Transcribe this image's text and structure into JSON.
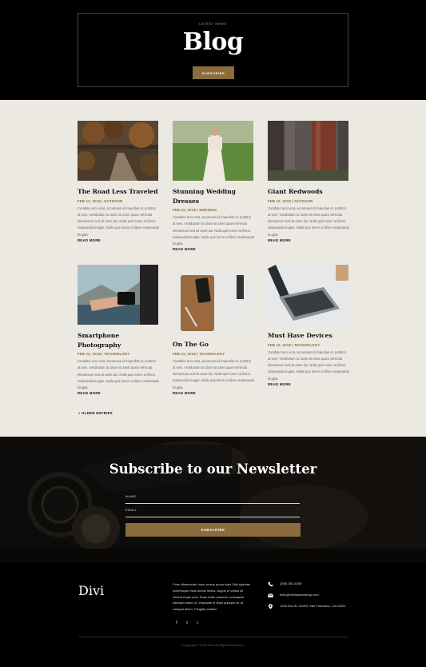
{
  "hero": {
    "kicker": "LATEST NEWS",
    "title": "Blog",
    "button": "SUBSCRIBE"
  },
  "posts": [
    {
      "title": "The Road Less Traveled",
      "meta": "FEB 12, 2018 | OUTDOOR",
      "body": "Curabitur arcu erat, accumsan id imperdiet et, porttitor at sem. Vestibulum ac diam sit amet quam vehicula elementum sed sit amet dui. Nulla quis lorem ut libero malesuada feugiat. Nulla quis lorem ut libero malesuada feugiat.",
      "more": "READ MORE"
    },
    {
      "title": "Stunning Wedding Dresses",
      "meta": "FEB 12, 2018 | WEDDING",
      "body": "Curabitur arcu erat, accumsan id imperdiet et, porttitor at sem. Vestibulum ac diam sit amet quam vehicula elementum sed sit amet dui. Nulla quis lorem ut libero malesuada feugiat. Nulla quis lorem ut libero malesuada feugiat.",
      "more": "READ MORE"
    },
    {
      "title": "Giant Redwoods",
      "meta": "FEB 12, 2018 | OUTDOOR",
      "body": "Curabitur arcu erat, accumsan id imperdiet et, porttitor at sem. Vestibulum ac diam sit amet quam vehicula elementum sed sit amet dui. Nulla quis lorem ut libero malesuada feugiat. Nulla quis lorem ut libero malesuada feugiat.",
      "more": "READ MORE"
    },
    {
      "title": "Smartphone Photography",
      "meta": "FEB 12, 2018 | TECHNOLOGY",
      "body": "Curabitur arcu erat, accumsan id imperdiet et, porttitor at sem. Vestibulum ac diam sit amet quam vehicula elementum sed sit amet dui. Nulla quis lorem ut libero malesuada feugiat. Nulla quis lorem ut libero malesuada feugiat.",
      "more": "READ MORE"
    },
    {
      "title": "On The Go",
      "meta": "FEB 12, 2018 | TECHNOLOGY",
      "body": "Curabitur arcu erat, accumsan id imperdiet et, porttitor at sem. Vestibulum ac diam sit amet quam vehicula elementum sed sit amet dui. Nulla quis lorem ut libero malesuada feugiat. Nulla quis lorem ut libero malesuada feugiat.",
      "more": "READ MORE"
    },
    {
      "title": "Must Have Devices",
      "meta": "FEB 12, 2018 | TECHNOLOGY",
      "body": "Curabitur arcu erat, accumsan id imperdiet et, porttitor at sem. Vestibulum ac diam sit amet quam vehicula elementum sed sit amet dui. Nulla quis lorem ut libero malesuada feugiat. Nulla quis lorem ut libero malesuada feugiat.",
      "more": "READ MORE"
    }
  ],
  "pagination": {
    "older": "« OLDER ENTRIES"
  },
  "newsletter": {
    "title": "Subscribe to our Newsletter",
    "name_label": "NAME",
    "email_label": "EMAIL",
    "button": "SUBSCRIBE"
  },
  "footer": {
    "logo": "Divi",
    "text": "Cras ullamcorper risus cursus purus eget. Nisl egestas scelerisque risus metus lectus. Augue ut varius sit viverra turpis cras. Diam tortor posuere consequat interdum amet ut. Vulputate id diam quisque ac at volutpat libero. Fringilla vestibu.",
    "phone": "(255) 352-6258",
    "email": "hello@divifashionshop.com",
    "address": "1234 Divi St. #1000, San Francisco, CA 94220",
    "social": [
      "f",
      "t",
      "i"
    ],
    "copyright": "Copyright © 2020 Divi. All Rights Reserved."
  },
  "colors": {
    "accent": "#8a6c3d",
    "background_light": "#ece8e2",
    "dark": "#000000"
  }
}
